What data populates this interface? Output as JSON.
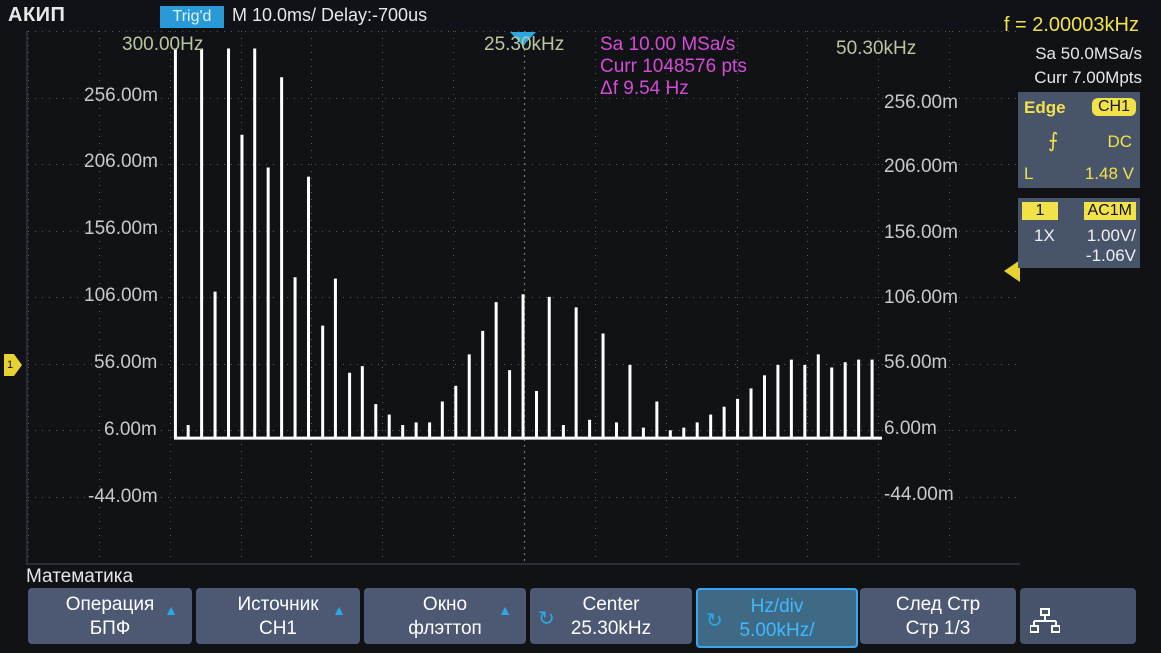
{
  "header": {
    "brand": "АКИП",
    "trig_status": "Trig'd",
    "timebase": "M 10.0ms/ Delay:-700us",
    "frequency": "f = 2.00003kHz"
  },
  "plot": {
    "freq_labels": {
      "left": "300.00Hz",
      "center": "25.30kHz",
      "right": "50.30kHz"
    },
    "magnitude_info": {
      "sa": "Sa 10.00 MSa/s",
      "curr": "Curr 1048576 pts",
      "df": "Δf 9.54 Hz"
    },
    "y_labels_left": [
      "256.00m",
      "206.00m",
      "156.00m",
      "106.00m",
      "56.00m",
      "6.00m",
      "-44.00m"
    ],
    "y_labels_right": [
      "256.00m",
      "206.00m",
      "156.00m",
      "106.00m",
      "56.00m",
      "6.00m",
      "-44.00m"
    ],
    "left_marker": "1",
    "colors": {
      "trace": "#ffffff",
      "grid": "#6f7a55",
      "magnitude": "#d64bd6",
      "trigger": "#f2e24a"
    }
  },
  "chart_data": {
    "type": "bar",
    "xlabel": "",
    "ylabel": "",
    "xlim": [
      300,
      50300
    ],
    "ylim": [
      -94,
      306
    ],
    "baseline": 0,
    "x": [
      400,
      1300,
      2250,
      3200,
      4150,
      5100,
      6000,
      6950,
      7900,
      8850,
      9800,
      10800,
      11700,
      12700,
      13600,
      14550,
      15500,
      16450,
      17400,
      18350,
      19250,
      20200,
      21150,
      22100,
      23050,
      24000,
      24950,
      25900,
      26800,
      27800,
      28700,
      29650,
      30600,
      31550,
      32500,
      33450,
      34400,
      35350,
      36300,
      37250,
      38200,
      39150,
      40100,
      41050,
      42000,
      42950,
      43900,
      44850,
      45800,
      46750,
      47700,
      48650,
      49600
    ],
    "values": [
      298,
      10,
      298,
      112,
      298,
      232,
      298,
      207,
      276,
      123,
      200,
      86,
      122,
      50,
      55,
      26,
      18,
      10,
      12,
      12,
      28,
      40,
      64,
      82,
      104,
      52,
      110,
      36,
      108,
      10,
      100,
      14,
      80,
      12,
      56,
      8,
      28,
      6,
      8,
      12,
      18,
      24,
      30,
      38,
      48,
      56,
      60,
      56,
      64,
      54,
      58,
      60,
      60
    ]
  },
  "right_panel": {
    "sa": "Sa 50.0MSa/s",
    "curr": "Curr 7.00Mpts",
    "trigger": {
      "type": "Edge",
      "source": "CH1",
      "slope_icon": "rising-edge-icon",
      "coupling": "DC",
      "level_label": "L",
      "level": "1.48 V"
    },
    "channel": {
      "number": "1",
      "coupling": "AC1M",
      "probe": "1X",
      "vdiv": "1.00V/",
      "offset": "-1.06V"
    }
  },
  "menu": {
    "title": "Математика",
    "keys": [
      {
        "line1": "Операция",
        "line2": "БПФ"
      },
      {
        "line1": "Источник",
        "line2": "CH1"
      },
      {
        "line1": "Окно",
        "line2": "флэттоп"
      },
      {
        "line1": "Center",
        "line2": "25.30kHz"
      },
      {
        "line1": "Hz/div",
        "line2": "5.00kHz/"
      },
      {
        "line1": "След Стр",
        "line2": "Стр 1/3"
      }
    ]
  }
}
